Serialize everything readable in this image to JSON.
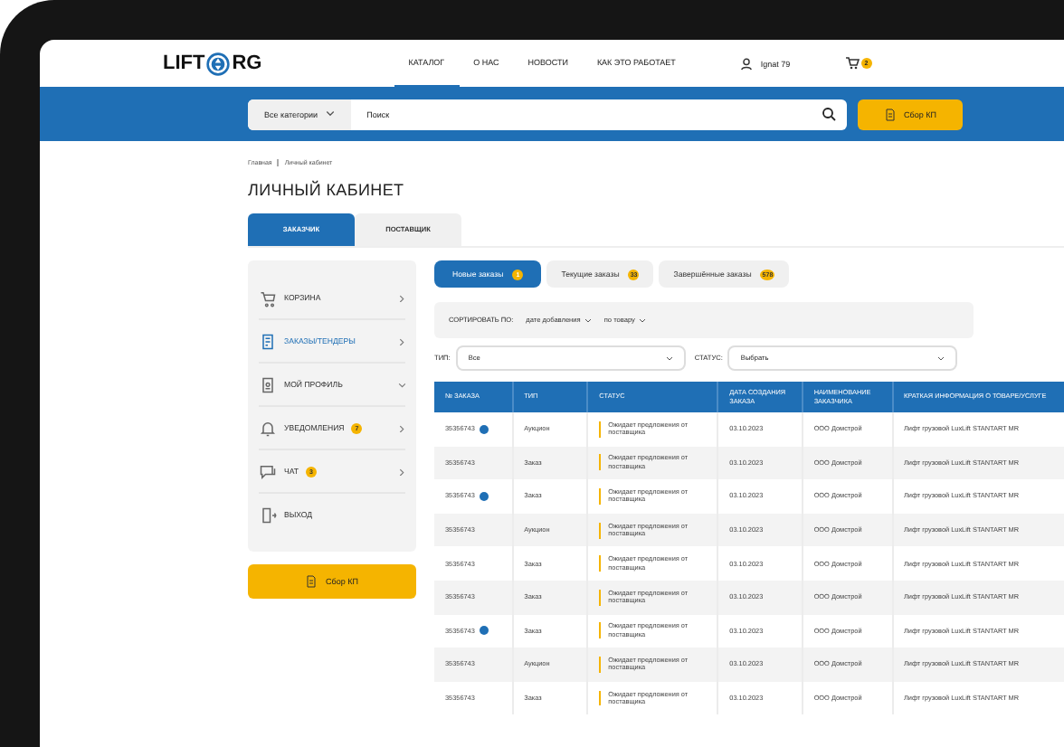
{
  "header": {
    "logo_left": "LIFT",
    "logo_right": "RG",
    "nav": [
      {
        "label": "КАТАЛОГ",
        "selected": true
      },
      {
        "label": "О НАС",
        "selected": false
      },
      {
        "label": "НОВОСТИ",
        "selected": false
      },
      {
        "label": "КАК ЭТО РАБОТАЕТ",
        "selected": false
      }
    ],
    "user": "Ignat 79",
    "cart_count": "2"
  },
  "search_bar": {
    "category": "Все категории",
    "placeholder": "Поиск",
    "button": "Сбор КП"
  },
  "breadcrumbs": [
    "Главная",
    "Личный кабинет"
  ],
  "title": "ЛИЧНЫЙ КАБИНЕТ",
  "role_tabs": [
    {
      "label": "ЗАКАЗЧИК",
      "selected": true
    },
    {
      "label": "ПОСТАВЩИК",
      "selected": false
    }
  ],
  "sidebar": {
    "items": [
      {
        "label": "КОРЗИНА",
        "kind": "link",
        "selected": false
      },
      {
        "label": "ЗАКАЗЫ/ТЕНДЕРЫ",
        "kind": "link",
        "selected": true
      },
      {
        "label": "МОЙ ПРОФИЛЬ",
        "kind": "menu",
        "selected": false
      },
      {
        "label": "УВЕДОМЛЕНИЯ",
        "kind": "link",
        "selected": false,
        "badge": "7"
      },
      {
        "label": "ЧАТ",
        "kind": "link",
        "selected": false,
        "badge": "3"
      },
      {
        "label": "ВЫХОД",
        "kind": "action",
        "selected": false
      }
    ],
    "button": "Сбор КП"
  },
  "order_tabs": [
    {
      "label": "Новые заказы",
      "count": "1",
      "selected": true
    },
    {
      "label": "Текущие заказы",
      "count": "33",
      "selected": false
    },
    {
      "label": "Завершённые заказы",
      "count": "578",
      "selected": false
    }
  ],
  "sort": {
    "label": "СОРТИРОВАТЬ ПО:",
    "options": [
      "дате добавления",
      "по товару"
    ]
  },
  "filters": [
    {
      "label": "ТИП:",
      "value": "Все"
    },
    {
      "label": "СТАТУС:",
      "value": "Выбрать"
    }
  ],
  "table": {
    "columns": [
      "№ ЗАКАЗА",
      "ТИП",
      "СТАТУС",
      "ДАТА СОЗДАНИЯ ЗАКАЗА",
      "НАИМЕНОВАНИЕ ЗАКАЗЧИКА",
      "КРАТКАЯ ИНФОРМАЦИЯ О ТОВАРЕ/УСЛУГЕ"
    ],
    "rows": [
      {
        "number": "35356743",
        "info": true,
        "type": "Аукцион",
        "status": "Ожидает предложения от поставщика",
        "date": "03.10.2023",
        "customer": "ООО Домстрой",
        "summary": "Лифт грузовой LuxLift STANTART MR"
      },
      {
        "number": "35356743",
        "info": false,
        "type": "Заказ",
        "status": "Ожидает предложения от поставщика",
        "date": "03.10.2023",
        "customer": "ООО Домстрой",
        "summary": "Лифт грузовой LuxLift STANTART MR"
      },
      {
        "number": "35356743",
        "info": true,
        "type": "Заказ",
        "status": "Ожидает предложения от поставщика",
        "date": "03.10.2023",
        "customer": "ООО Домстрой",
        "summary": "Лифт грузовой LuxLift STANTART MR"
      },
      {
        "number": "35356743",
        "info": false,
        "type": "Аукцион",
        "status": "Ожидает предложения от поставщика",
        "date": "03.10.2023",
        "customer": "ООО Домстрой",
        "summary": "Лифт грузовой LuxLift STANTART MR"
      },
      {
        "number": "35356743",
        "info": false,
        "type": "Заказ",
        "status": "Ожидает предложения от поставщика",
        "date": "03.10.2023",
        "customer": "ООО Домстрой",
        "summary": "Лифт грузовой LuxLift STANTART MR"
      },
      {
        "number": "35356743",
        "info": false,
        "type": "Заказ",
        "status": "Ожидает предложения от поставщика",
        "date": "03.10.2023",
        "customer": "ООО Домстрой",
        "summary": "Лифт грузовой LuxLift STANTART MR"
      },
      {
        "number": "35356743",
        "info": true,
        "type": "Заказ",
        "status": "Ожидает предложения от поставщика",
        "date": "03.10.2023",
        "customer": "ООО Домстрой",
        "summary": "Лифт грузовой LuxLift STANTART MR"
      },
      {
        "number": "35356743",
        "info": false,
        "type": "Аукцион",
        "status": "Ожидает предложения от поставщика",
        "date": "03.10.2023",
        "customer": "ООО Домстрой",
        "summary": "Лифт грузовой LuxLift STANTART MR"
      },
      {
        "number": "35356743",
        "info": false,
        "type": "Заказ",
        "status": "Ожидает предложения от поставщика",
        "date": "03.10.2023",
        "customer": "ООО Домстрой",
        "summary": "Лифт грузовой LuxLift STANTART MR"
      }
    ]
  }
}
